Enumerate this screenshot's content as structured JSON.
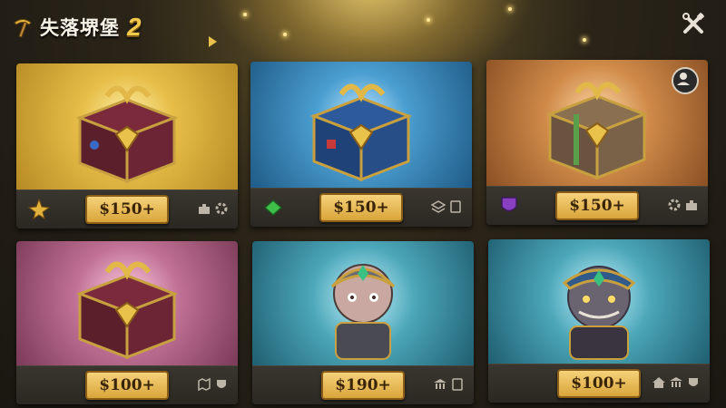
{
  "header": {
    "title": "失落堺堡",
    "title_number": "2",
    "logo_icon": "pickaxe-icon",
    "settings_icon": "tools-icon"
  },
  "cards": [
    {
      "price": "$150+",
      "theme": "gold",
      "item": "treasure-chest",
      "tier_icon": "gold-star-icon",
      "meta_icons": [
        "puzzle-icon",
        "gear-icon"
      ]
    },
    {
      "price": "$150+",
      "theme": "blue",
      "item": "treasure-chest",
      "tier_icon": "green-gem-icon",
      "meta_icons": [
        "layers-icon",
        "card-icon"
      ]
    },
    {
      "price": "$150+",
      "theme": "bronze",
      "item": "treasure-chest",
      "tier_icon": "purple-shield-icon",
      "meta_icons": [
        "gear-icon",
        "puzzle-icon"
      ],
      "corner_icon": "profile-icon"
    },
    {
      "price": "$100+",
      "theme": "pink",
      "item": "treasure-chest",
      "meta_icons": [
        "map-icon",
        "shield-icon"
      ]
    },
    {
      "price": "$190+",
      "theme": "teal",
      "item": "armored-hero",
      "meta_icons": [
        "bank-icon",
        "card-icon"
      ]
    },
    {
      "price": "$100+",
      "theme": "teal",
      "item": "armored-beast",
      "meta_icons": [
        "home-icon",
        "bank-icon",
        "shield-icon"
      ]
    }
  ],
  "colors": {
    "gold": "#c99a2e",
    "blue": "#2f79a8",
    "bronze": "#b87a3e",
    "pink": "#b0607e",
    "teal": "#3a8a9c",
    "price_bg": "#e8b94e",
    "price_text": "#3a2408"
  }
}
